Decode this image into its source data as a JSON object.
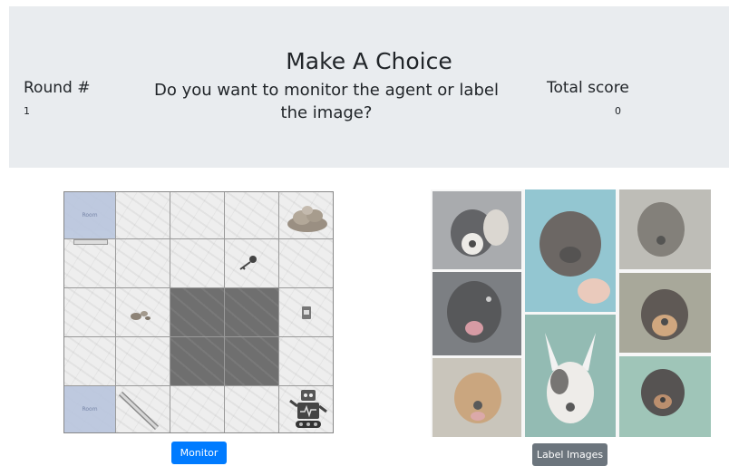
{
  "header": {
    "title": "Make A Choice",
    "round_label": "Round #",
    "round_value": "1",
    "question": "Do you want to monitor the agent or label the image?",
    "score_label": "Total score",
    "score_value": "0"
  },
  "grid": {
    "room_label": "Room"
  },
  "buttons": {
    "monitor": "Monitor",
    "label_images": "Label Images"
  },
  "icons": [
    "rocks-icon",
    "key-icon",
    "pebbles-icon",
    "cup-icon",
    "robot-icon",
    "pipe-icon"
  ],
  "colors": {
    "header_bg": "#e9ecef",
    "monitor_button": "#007bff",
    "label_button": "#6c757d"
  }
}
